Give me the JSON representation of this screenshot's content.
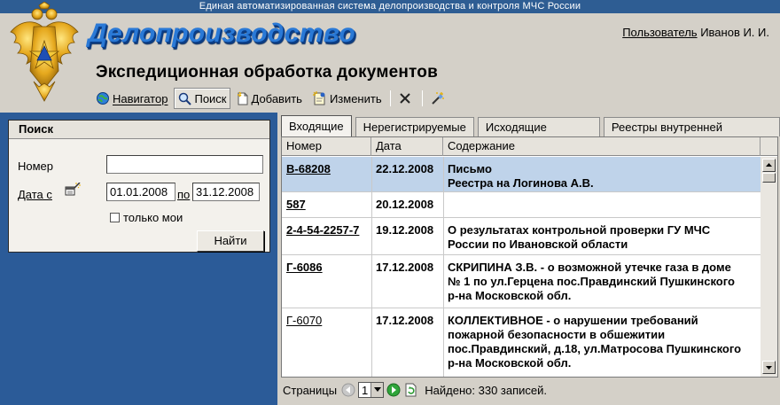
{
  "topbar": {
    "text": "Единая автоматизированная система делопроизводства и контроля МЧС России"
  },
  "header": {
    "app_title": "Делопроизводство",
    "user_label": "Пользователь",
    "user_name": "Иванов И. И.",
    "page_title": "Экспедиционная обработка документов"
  },
  "toolbar": {
    "navigator": "Навигатор",
    "search": "Поиск",
    "add": "Добавить",
    "edit": "Изменить"
  },
  "search": {
    "title": "Поиск",
    "number_label": "Номер",
    "number_value": "",
    "date_from_label": "Дата с",
    "date_from": "01.01.2008",
    "date_to_label": "по",
    "date_to": "31.12.2008",
    "only_mine_label": "только мои",
    "only_mine_checked": false,
    "find_button": "Найти"
  },
  "tabs": [
    {
      "label": "Входящие",
      "active": true
    },
    {
      "label": "Нерегистрируемые",
      "active": false
    },
    {
      "label": "Исходящие реестры",
      "active": false
    },
    {
      "label": "Реестры внутренней рассылки",
      "active": false
    }
  ],
  "grid": {
    "columns": [
      "Номер",
      "Дата",
      "Содержание"
    ],
    "rows": [
      {
        "number": "В-68208",
        "date": "22.12.2008",
        "lines": [
          "Письмо",
          "Реестра на Логинова А.В."
        ],
        "selected": true,
        "bold": true
      },
      {
        "number": "587",
        "date": "20.12.2008",
        "lines": [],
        "selected": false,
        "bold": true
      },
      {
        "number": "2-4-54-2257-7",
        "date": "19.12.2008",
        "lines": [
          "О результатах контрольной проверки ГУ МЧС",
          "России по Ивановской области"
        ],
        "selected": false,
        "bold": true
      },
      {
        "number": "Г-6086",
        "date": "17.12.2008",
        "lines": [
          "СКРИПИНА З.В. - о возможной утечке газа в доме",
          "№ 1 по ул.Герцена пос.Правдинский Пушкинского",
          "р-на Московской обл."
        ],
        "selected": false,
        "bold": true
      },
      {
        "number": "Г-6070",
        "date": "17.12.2008",
        "lines": [
          "КОЛЛЕКТИВНОЕ - о нарушении требований",
          "пожарной безопасности в обшежитии",
          "пос.Правдинский, д.18, ул.Матросова Пушкинского",
          "р-на Московской обл."
        ],
        "selected": false,
        "bold": false
      }
    ]
  },
  "pager": {
    "pages_label": "Страницы",
    "current_page": "1",
    "found_text": "Найдено: 330 записей."
  }
}
